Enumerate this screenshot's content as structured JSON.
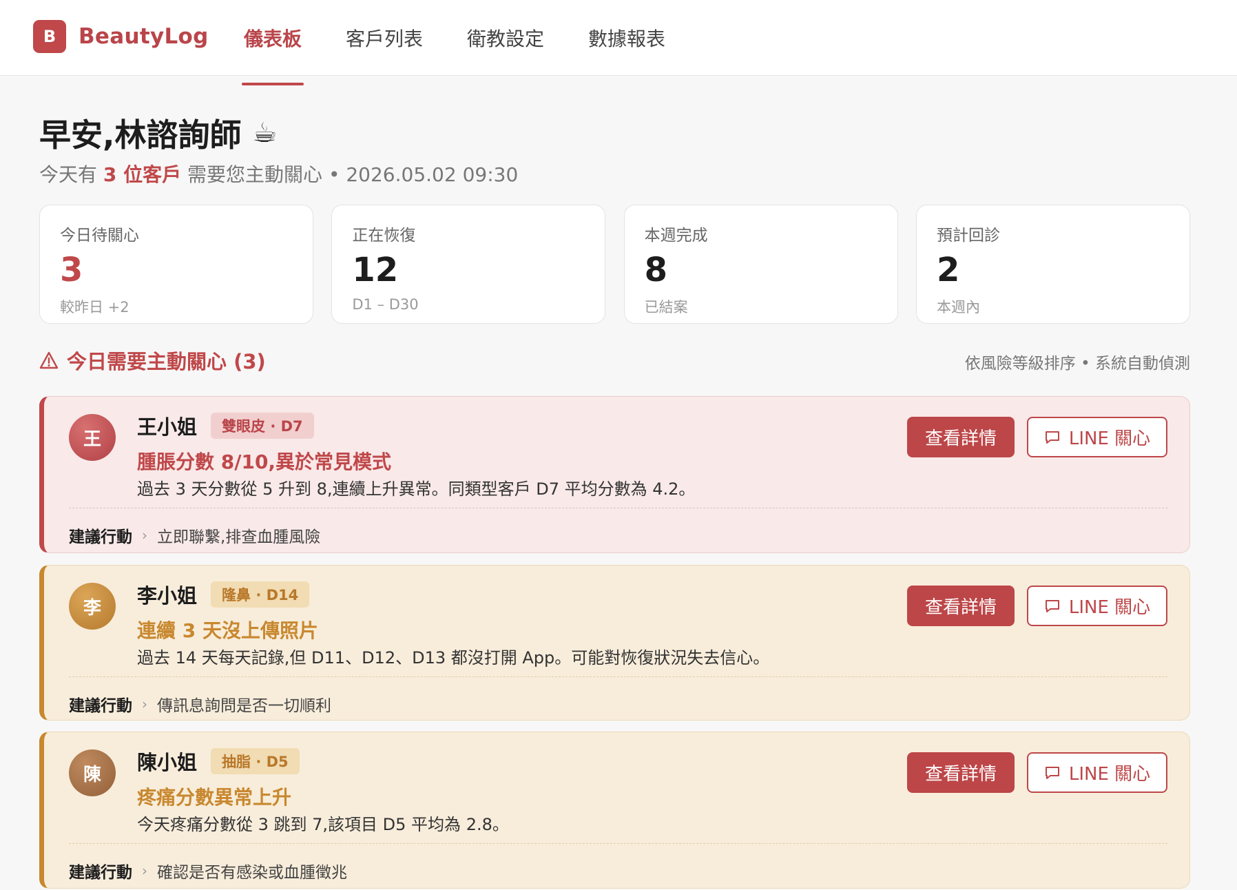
{
  "brand": {
    "mark": "B",
    "name": "BeautyLog"
  },
  "nav": {
    "items": [
      "儀表板",
      "客戶列表",
      "衛教設定",
      "數據報表"
    ]
  },
  "greeting": {
    "title": "早安,林諮詢師",
    "emoji": "☕"
  },
  "subline": {
    "prefix": "今天有 ",
    "highlight": "3 位客戶",
    "suffix": " 需要您主動關心 • 2026.05.02 09:30"
  },
  "stats": [
    {
      "label": "今日待關心",
      "value": "3",
      "note": "較昨日 +2"
    },
    {
      "label": "正在恢復",
      "value": "12",
      "note": "D1 – D30"
    },
    {
      "label": "本週完成",
      "value": "8",
      "note": "已結案"
    },
    {
      "label": "預計回診",
      "value": "2",
      "note": "本週內"
    }
  ],
  "section": {
    "title": "今日需要主動關心 (3)",
    "sort_note": "依風險等級排序 • 系統自動偵測"
  },
  "labels": {
    "action_key": "建議行動",
    "chevron": "›",
    "view_detail": "查看詳情",
    "line_care": "LINE 關心"
  },
  "clients": [
    {
      "avatar": "王",
      "name": "王小姐",
      "tag": "雙眼皮 · D7",
      "alert": "腫脹分數 8/10,異於常見模式",
      "detail": "過去 3 天分數從 5 升到 8,連續上升異常。同類型客戶 D7 平均分數為 4.2。",
      "action": "立即聯繫,排查血腫風險"
    },
    {
      "avatar": "李",
      "name": "李小姐",
      "tag": "隆鼻 · D14",
      "alert": "連續 3 天沒上傳照片",
      "detail": "過去 14 天每天記錄,但 D11、D12、D13 都沒打開 App。可能對恢復狀況失去信心。",
      "action": "傳訊息詢問是否一切順利"
    },
    {
      "avatar": "陳",
      "name": "陳小姐",
      "tag": "抽脂 · D5",
      "alert": "疼痛分數異常上升",
      "detail": "今天疼痛分數從 3 跳到 7,該項目 D5 平均為 2.8。",
      "action": "確認是否有感染或血腫徵兆"
    }
  ],
  "colors": {
    "accent": "#c0484a",
    "warning": "#c8882f",
    "alert_bg": "#f9e9e9",
    "warning_bg": "#f8eddb"
  }
}
